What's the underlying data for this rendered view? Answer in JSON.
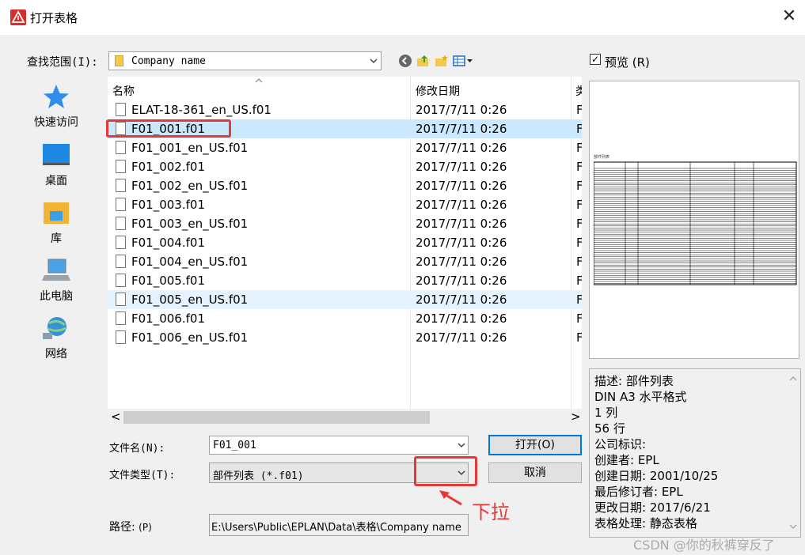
{
  "window": {
    "title": "打开表格",
    "close_glyph": "✕"
  },
  "lookin": {
    "label": "查找范围(I):",
    "value": "Company name"
  },
  "toolbar": {
    "icons": [
      "back-icon",
      "up-folder-icon",
      "new-folder-icon",
      "view-menu-icon"
    ]
  },
  "preview_toggle": {
    "label": "预览 (R)",
    "checked": true,
    "check_glyph": "✓"
  },
  "places": [
    {
      "label": "快速访问",
      "icon": "star-icon"
    },
    {
      "label": "桌面",
      "icon": "desktop-icon"
    },
    {
      "label": "库",
      "icon": "library-icon"
    },
    {
      "label": "此电脑",
      "icon": "computer-icon"
    },
    {
      "label": "网络",
      "icon": "network-icon"
    }
  ],
  "filelist": {
    "columns": [
      "名称",
      "修改日期",
      "类"
    ],
    "rows": [
      {
        "name": "ELAT-18-361_en_US.f01",
        "date": "2017/7/11 0:26",
        "type": "F",
        "state": ""
      },
      {
        "name": "F01_001.f01",
        "date": "2017/7/11 0:26",
        "type": "F",
        "state": "selected"
      },
      {
        "name": "F01_001_en_US.f01",
        "date": "2017/7/11 0:26",
        "type": "F",
        "state": ""
      },
      {
        "name": "F01_002.f01",
        "date": "2017/7/11 0:26",
        "type": "F",
        "state": ""
      },
      {
        "name": "F01_002_en_US.f01",
        "date": "2017/7/11 0:26",
        "type": "F",
        "state": ""
      },
      {
        "name": "F01_003.f01",
        "date": "2017/7/11 0:26",
        "type": "F",
        "state": ""
      },
      {
        "name": "F01_003_en_US.f01",
        "date": "2017/7/11 0:26",
        "type": "F",
        "state": ""
      },
      {
        "name": "F01_004.f01",
        "date": "2017/7/11 0:26",
        "type": "F",
        "state": ""
      },
      {
        "name": "F01_004_en_US.f01",
        "date": "2017/7/11 0:26",
        "type": "F",
        "state": ""
      },
      {
        "name": "F01_005.f01",
        "date": "2017/7/11 0:26",
        "type": "F",
        "state": ""
      },
      {
        "name": "F01_005_en_US.f01",
        "date": "2017/7/11 0:26",
        "type": "F",
        "state": "hover"
      },
      {
        "name": "F01_006.f01",
        "date": "2017/7/11 0:26",
        "type": "F",
        "state": ""
      },
      {
        "name": "F01_006_en_US.f01",
        "date": "2017/7/11 0:26",
        "type": "F",
        "state": ""
      }
    ]
  },
  "scroll": {
    "left_glyph": "<",
    "right_glyph": ">"
  },
  "filename": {
    "label": "文件名(N):",
    "value": "F01_001"
  },
  "filetype": {
    "label": "文件类型(T):",
    "value": "部件列表 (*.f01)"
  },
  "path": {
    "label": "路径:",
    "hotkey": "(P)",
    "value": "E:\\Users\\Public\\EPLAN\\Data\\表格\\Company name"
  },
  "buttons": {
    "open": "打开(O)",
    "cancel": "取消"
  },
  "preview": {
    "caption": "部件列表"
  },
  "description": [
    "描述: 部件列表",
    "DIN A3 水平格式",
    "1 列",
    "56 行",
    "公司标识:",
    "创建者: EPL",
    "创建日期: 2001/10/25",
    "最后修订者: EPL",
    "更改日期: 2017/6/21",
    "表格处理: 静态表格"
  ],
  "annotation": {
    "text": "下拉",
    "color": "#e53935"
  },
  "watermark": "CSDN @你的秋裤穿反了"
}
